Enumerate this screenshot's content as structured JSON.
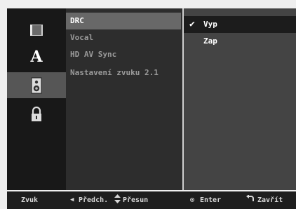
{
  "sidebar": {
    "icons": [
      {
        "name": "disc-icon",
        "selected": false
      },
      {
        "name": "language-icon",
        "glyph": "A",
        "selected": false
      },
      {
        "name": "speaker-icon",
        "selected": true
      },
      {
        "name": "lock-icon",
        "selected": false
      }
    ]
  },
  "menu": {
    "items": [
      "DRC",
      "Vocal",
      "HD AV Sync",
      "Nastavení zvuku 2.1"
    ],
    "active_index": 0
  },
  "options": {
    "items": [
      "Vyp",
      "Zap"
    ],
    "selected_index": 0,
    "check_glyph": "✔"
  },
  "footer": {
    "section": "Zvuk",
    "prev_label": "Předch.",
    "move_label": "Přesun",
    "enter_label": "Enter",
    "close_label": "Zavřít"
  },
  "colors": {
    "highlight": "#686868",
    "icon_selected": "#565656",
    "option_active": "#1c1c1c"
  }
}
